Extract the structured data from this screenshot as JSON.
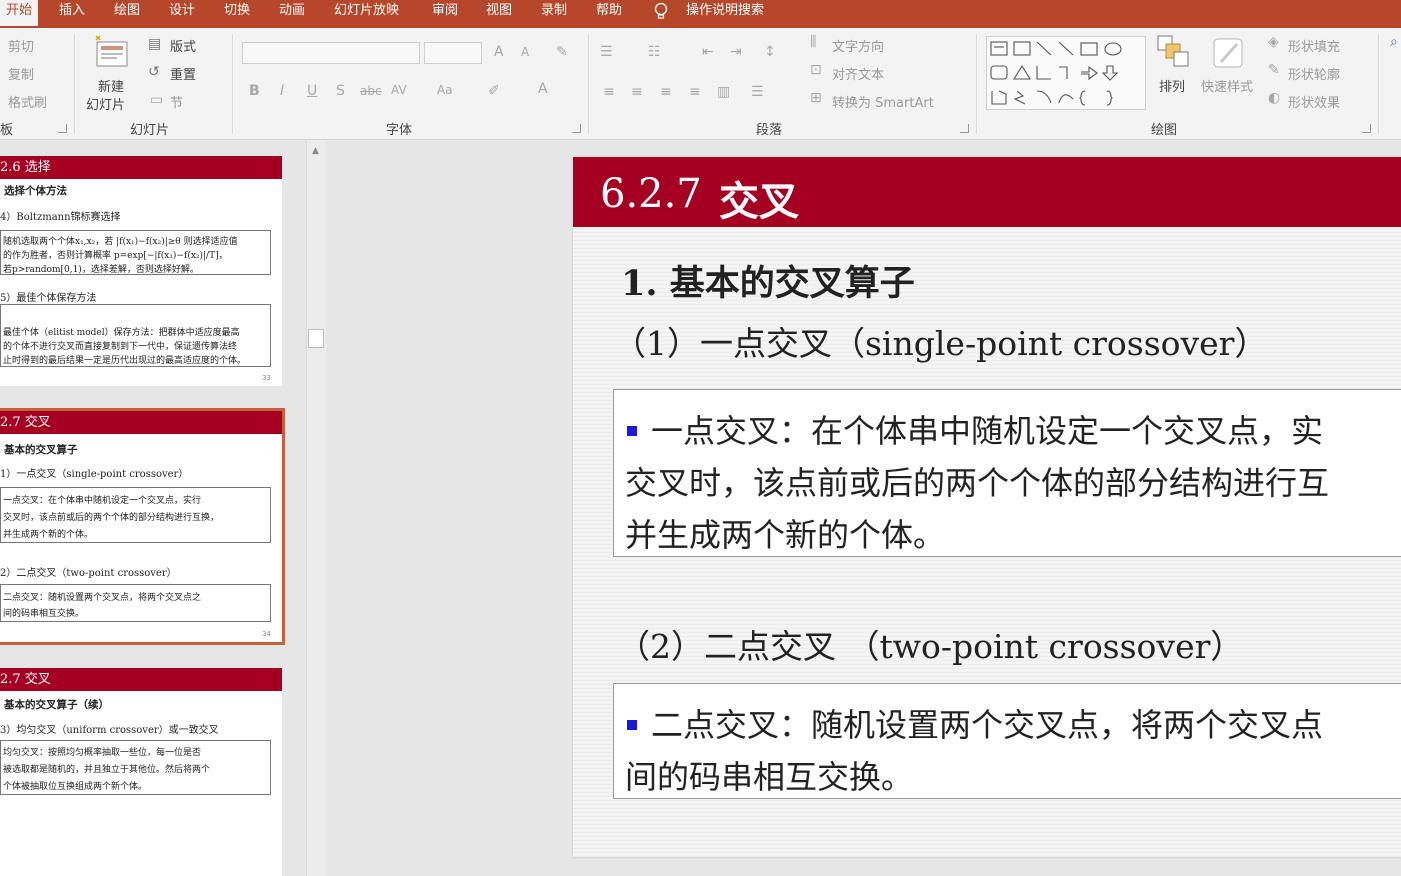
{
  "ribbon_tabs": [
    "开始",
    "插入",
    "绘图",
    "设计",
    "切换",
    "动画",
    "幻灯片放映",
    "审阅",
    "视图",
    "录制",
    "帮助"
  ],
  "tell_me": "操作说明搜索",
  "clipboard": {
    "cut": "剪切",
    "copy": "复制",
    "format_painter": "格式刷",
    "label": "板"
  },
  "slides_group": {
    "new_slide_line1": "新建",
    "new_slide_line2": "幻灯片",
    "layout": "版式",
    "reset": "重置",
    "section": "节",
    "label": "幻灯片"
  },
  "font_group": {
    "label": "字体",
    "bold": "B",
    "italic": "I",
    "underline": "U",
    "shadow": "S",
    "strike": "abc",
    "spacing": "AV",
    "case": "Aa",
    "grow": "A",
    "shrink": "A",
    "color": "A"
  },
  "paragraph_group": {
    "label": "段落",
    "text_direction": "文字方向",
    "align_text": "对齐文本",
    "smartart": "转换为 SmartArt"
  },
  "drawing_group": {
    "label": "绘图",
    "arrange": "排列",
    "quick_styles": "快速样式",
    "shape_fill": "形状填充",
    "shape_outline": "形状轮廓",
    "shape_effects": "形状效果"
  },
  "thumbnails": [
    {
      "title": "2.6 选择",
      "lines": [
        "选择个体方法",
        "4）Boltzmann锦标赛选择"
      ],
      "box1": [
        "随机选取两个个体x₁,x₂，若 |f(x₁)−f(x₂)|≥θ 则选择适应值",
        "的作为胜者，否则计算概率 p=exp[−|f(x₁)−f(x₂)|/T]，",
        "若p>random[0,1)，选择差解，否则选择好解。"
      ],
      "line3": "5）最佳个体保存方法",
      "box2": [
        "最佳个体（elitist model）保存方法：把群体中适应度最高",
        "的个体不进行交叉而直接复制到下一代中，保证遗传算法终",
        "止时得到的最后结果一定是历代出现过的最高适应度的个体。"
      ],
      "page": "33"
    },
    {
      "title": "2.7 交叉",
      "lines": [
        "基本的交叉算子",
        "1）一点交叉（single-point crossover）"
      ],
      "box1": [
        "一点交叉：在个体串中随机设定一个交叉点，实行",
        "交叉时，该点前或后的两个个体的部分结构进行互换，",
        "并生成两个新的个体。"
      ],
      "line3": "2）二点交叉（two-point crossover）",
      "box2": [
        "二点交叉：随机设置两个交叉点，将两个交叉点之",
        "间的码串相互交换。"
      ],
      "page": "34"
    },
    {
      "title": "2.7 交叉",
      "lines": [
        "基本的交叉算子（续）",
        "3）均匀交叉（uniform crossover）或一致交叉"
      ],
      "box1": [
        "均匀交叉：按照均匀概率抽取一些位，每一位是否",
        "被选取都是随机的，并且独立于其他位。然后将两个",
        "个体被抽取位互换组成两个新个体。"
      ]
    }
  ],
  "slide": {
    "number": "6.2.7",
    "title": "交叉",
    "heading": "1. 基本的交叉算子",
    "sub1": "（1）一点交叉（single-point crossover）",
    "box1": [
      "一点交叉：在个体串中随机设定一个交叉点，实",
      "交叉时，该点前或后的两个个体的部分结构进行互",
      "并生成两个新的个体。"
    ],
    "sub2": "（2）二点交叉 （two-point crossover）",
    "box2": [
      "二点交叉：随机设置两个交叉点，将两个交叉点",
      "间的码串相互交换。"
    ]
  },
  "colors": {
    "ribbon": "#b7472a",
    "slide_header": "#a50021",
    "bullet": "#1a1adf"
  }
}
